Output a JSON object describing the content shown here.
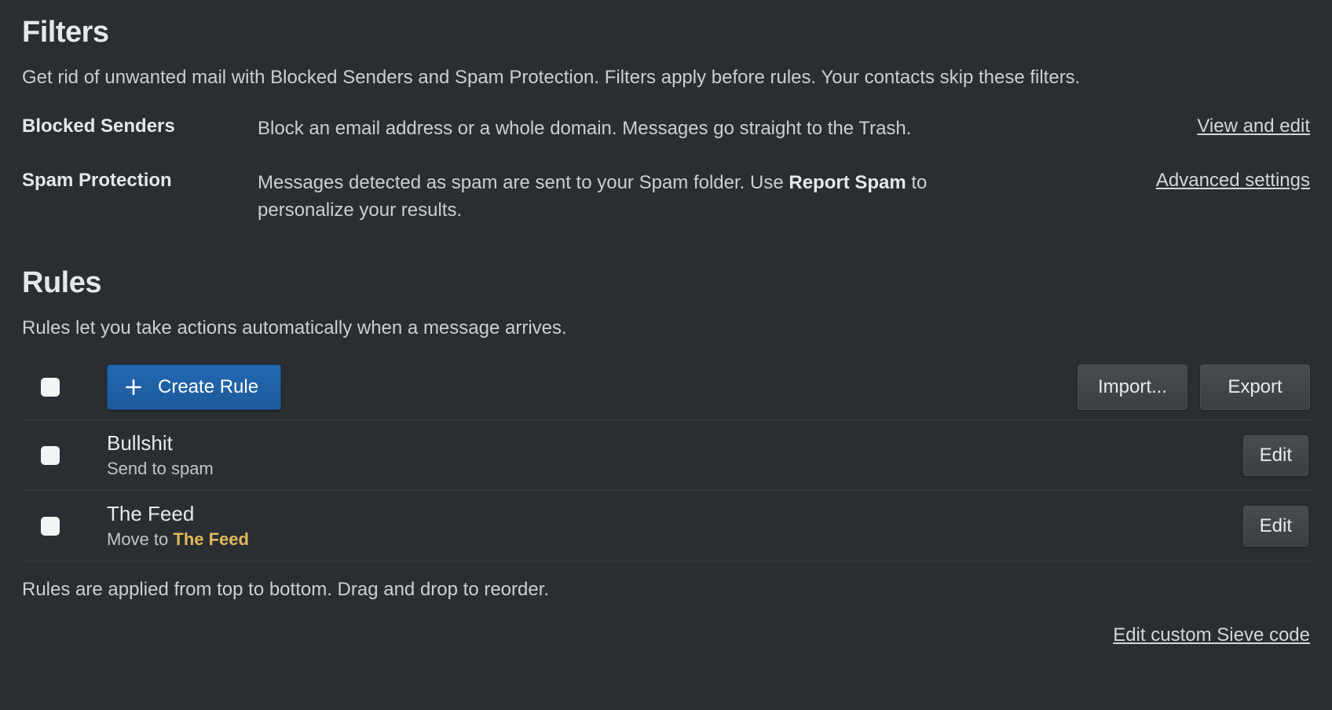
{
  "filters": {
    "heading": "Filters",
    "description": "Get rid of unwanted mail with Blocked Senders and Spam Protection. Filters apply before rules. Your contacts skip these filters.",
    "blocked_senders": {
      "label": "Blocked Senders",
      "description": "Block an email address or a whole domain. Messages go straight to the Trash.",
      "action": "View and edit"
    },
    "spam_protection": {
      "label": "Spam Protection",
      "desc_before": "Messages detected as spam are sent to your Spam folder. Use ",
      "desc_bold": "Report Spam",
      "desc_after": " to personalize your results.",
      "action": "Advanced settings"
    }
  },
  "rules": {
    "heading": "Rules",
    "description": "Rules let you take actions automatically when a message arrives.",
    "create_label": "Create Rule",
    "import_label": "Import...",
    "export_label": "Export",
    "edit_label": "Edit",
    "items": [
      {
        "name": "Bullshit",
        "sub_prefix": "Send to spam",
        "sub_folder": ""
      },
      {
        "name": "The Feed",
        "sub_prefix": "Move to ",
        "sub_folder": "The Feed"
      }
    ],
    "footer": "Rules are applied from top to bottom. Drag and drop to reorder.",
    "sieve_link": "Edit custom Sieve code"
  }
}
